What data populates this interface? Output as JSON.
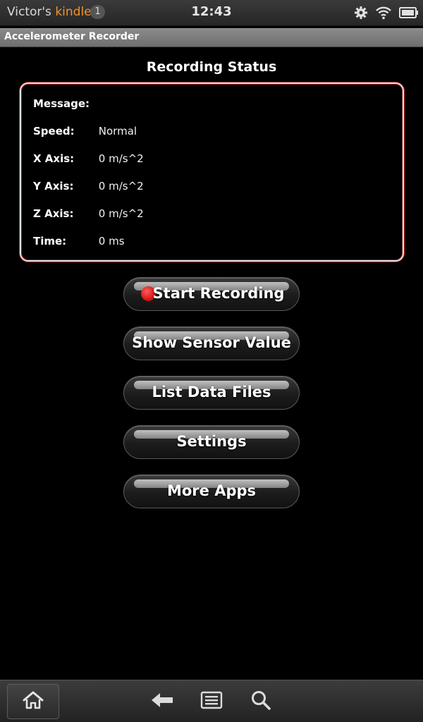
{
  "status_bar": {
    "owner_prefix": "Victor's",
    "owner_brand": "kindle",
    "notification_count": "1",
    "time": "12:43",
    "icons": [
      "gear-icon",
      "wifi-icon",
      "battery-icon"
    ]
  },
  "app": {
    "title": "Accelerometer Recorder"
  },
  "status_section": {
    "heading": "Recording Status",
    "rows": [
      {
        "label": "Message:",
        "value": ""
      },
      {
        "label": "Speed:",
        "value": "Normal"
      },
      {
        "label": "X Axis:",
        "value": "0 m/s^2"
      },
      {
        "label": "Y Axis:",
        "value": "0 m/s^2"
      },
      {
        "label": "Z Axis:",
        "value": "0 m/s^2"
      },
      {
        "label": "Time:",
        "value": "0 ms"
      }
    ]
  },
  "buttons": {
    "start_recording": "Start Recording",
    "show_sensor_value": "Show Sensor Value",
    "list_data_files": "List Data Files",
    "settings": "Settings",
    "more_apps": "More Apps"
  },
  "bottom_nav": {
    "icons": [
      "home-icon",
      "back-icon",
      "menu-icon",
      "search-icon"
    ]
  },
  "colors": {
    "background": "#000000",
    "brand_orange": "#f0932b",
    "record_red": "#d41a1a",
    "panel_border": "#e0e0e0"
  }
}
